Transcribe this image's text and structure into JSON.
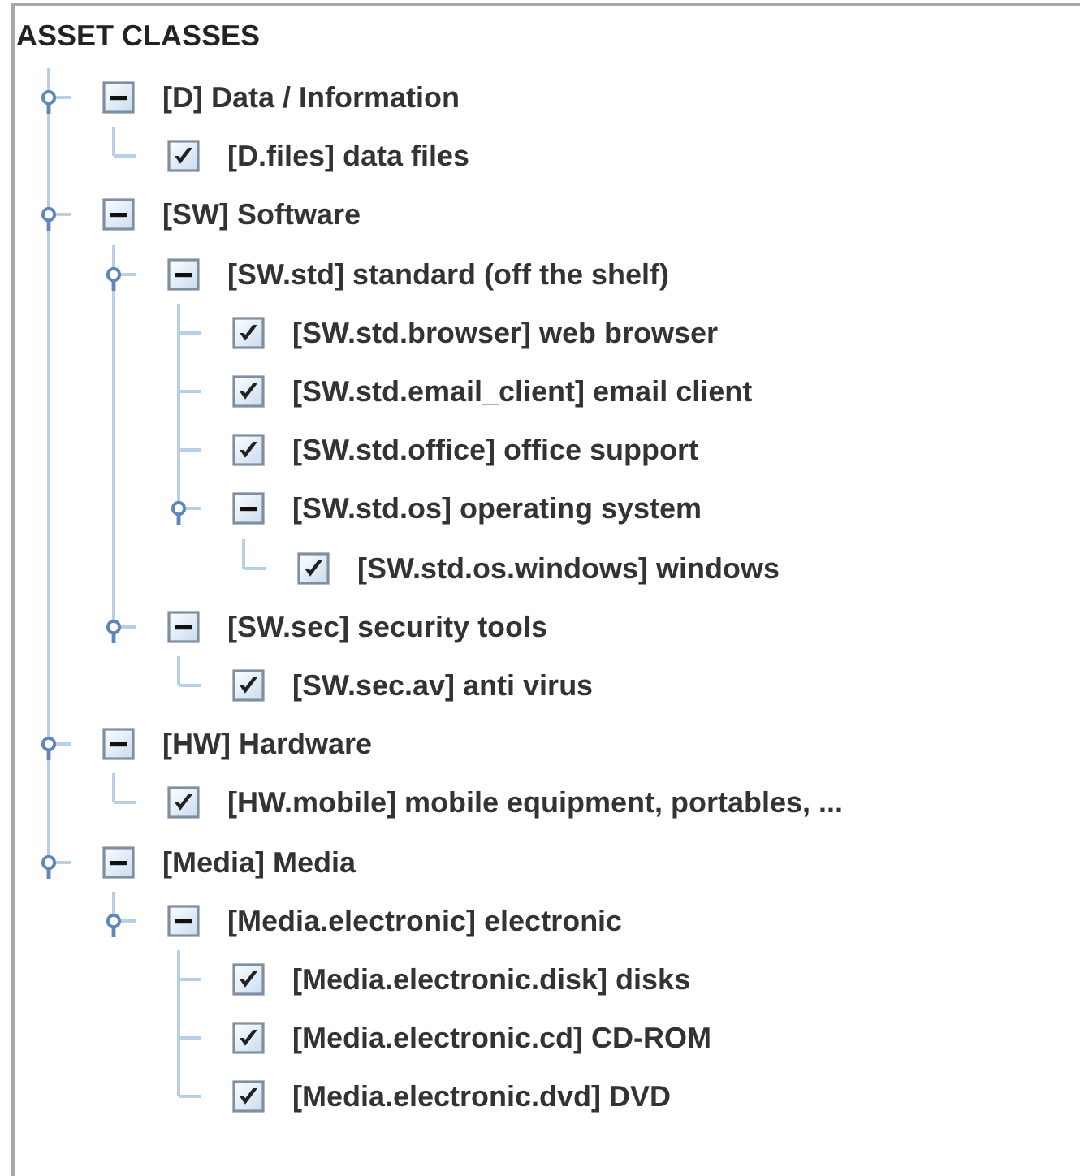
{
  "title": "ASSET CLASSES",
  "tree": [
    {
      "label": "[D] Data / Information",
      "kind": "category",
      "expanded": true,
      "children": [
        {
          "label": "[D.files] data files",
          "kind": "item",
          "checked": true
        }
      ]
    },
    {
      "label": "[SW] Software",
      "kind": "category",
      "expanded": true,
      "children": [
        {
          "label": "[SW.std] standard (off the shelf)",
          "kind": "category",
          "expanded": true,
          "children": [
            {
              "label": "[SW.std.browser] web browser",
              "kind": "item",
              "checked": true
            },
            {
              "label": "[SW.std.email_client] email client",
              "kind": "item",
              "checked": true
            },
            {
              "label": "[SW.std.office] office support",
              "kind": "item",
              "checked": true
            },
            {
              "label": "[SW.std.os] operating system",
              "kind": "category",
              "expanded": true,
              "children": [
                {
                  "label": "[SW.std.os.windows] windows",
                  "kind": "item",
                  "checked": true
                }
              ]
            }
          ]
        },
        {
          "label": "[SW.sec] security tools",
          "kind": "category",
          "expanded": true,
          "children": [
            {
              "label": "[SW.sec.av] anti virus",
              "kind": "item",
              "checked": true
            }
          ]
        }
      ]
    },
    {
      "label": "[HW] Hardware",
      "kind": "category",
      "expanded": true,
      "children": [
        {
          "label": "[HW.mobile] mobile equipment, portables, ...",
          "kind": "item",
          "checked": true
        }
      ]
    },
    {
      "label": "[Media] Media",
      "kind": "category",
      "expanded": true,
      "children": [
        {
          "label": "[Media.electronic] electronic",
          "kind": "category",
          "expanded": true,
          "children": [
            {
              "label": "[Media.electronic.disk] disks",
              "kind": "item",
              "checked": true
            },
            {
              "label": "[Media.electronic.cd] CD-ROM",
              "kind": "item",
              "checked": true
            },
            {
              "label": "[Media.electronic.dvd] DVD",
              "kind": "item",
              "checked": true
            }
          ]
        }
      ]
    }
  ]
}
